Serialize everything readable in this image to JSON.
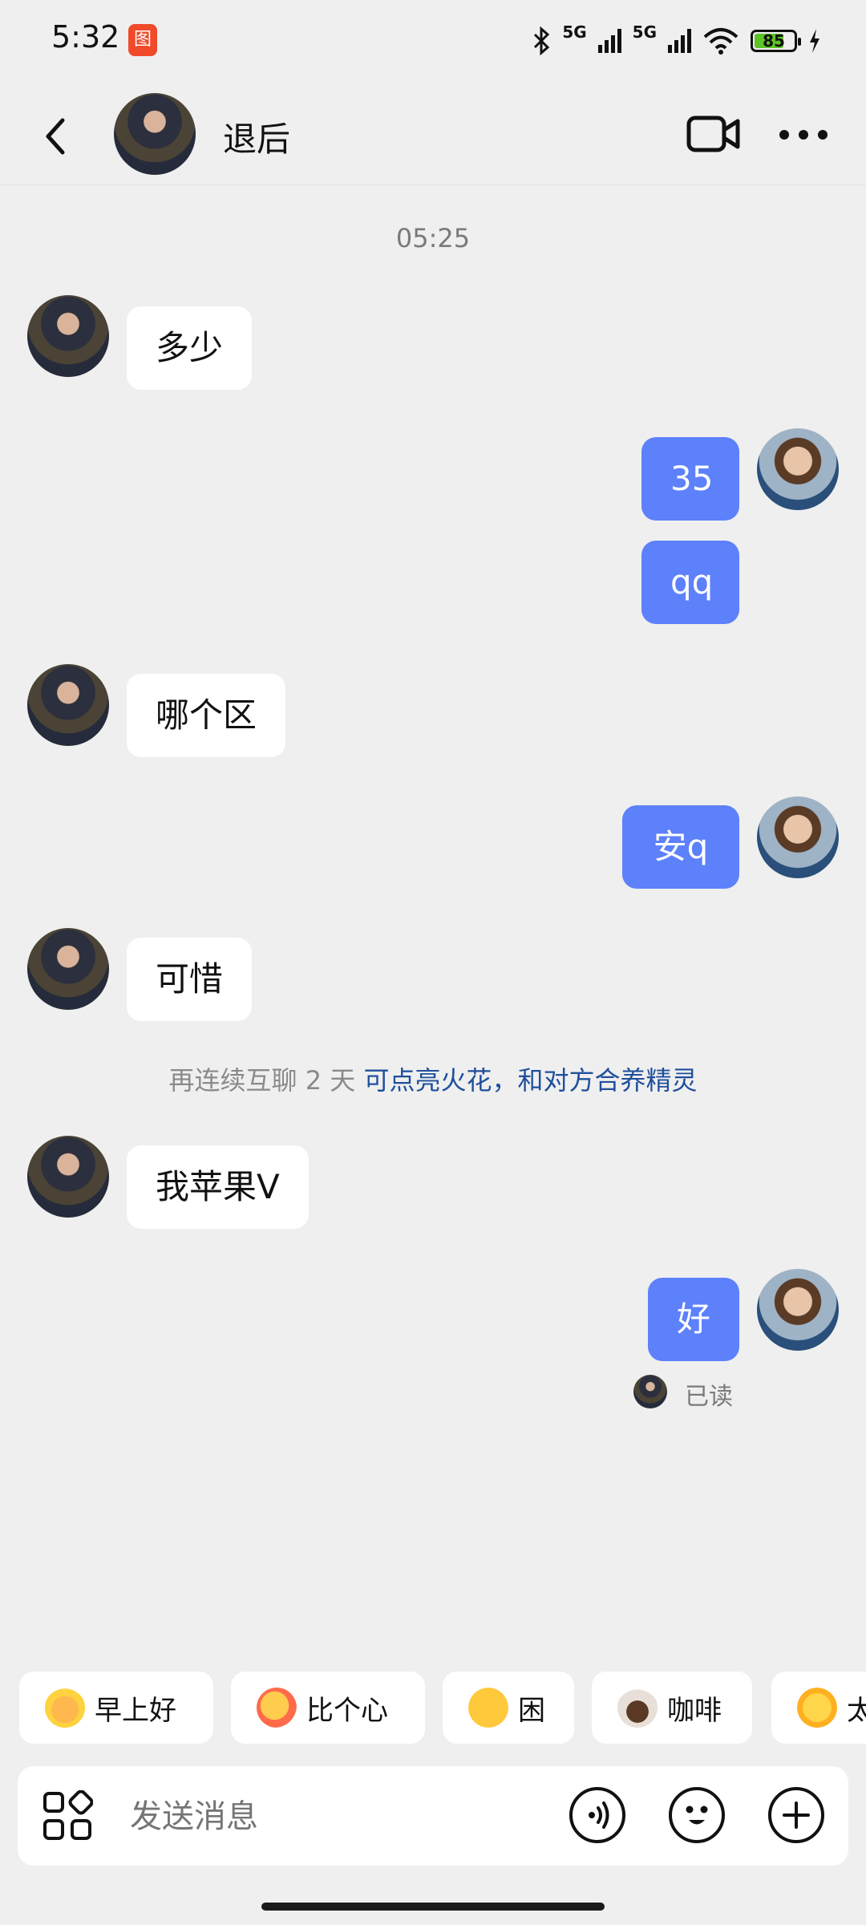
{
  "status_bar": {
    "time": "5:32",
    "app_badge": "图",
    "net1": "5G",
    "net2": "5G",
    "battery": "85"
  },
  "header": {
    "contact_name": "退后",
    "icons": [
      "back-icon",
      "video-call-icon",
      "more-icon"
    ]
  },
  "chat": {
    "timestamp": "05:25",
    "messages": [
      {
        "from": "contact",
        "text": "多少"
      },
      {
        "from": "me",
        "text": "35"
      },
      {
        "from": "me",
        "text": "qq"
      },
      {
        "from": "contact",
        "text": "哪个区"
      },
      {
        "from": "me",
        "text": "安q"
      },
      {
        "from": "contact",
        "text": "可惜"
      },
      {
        "from": "contact",
        "text": "我苹果V"
      },
      {
        "from": "me",
        "text": "好"
      }
    ],
    "hint_prefix": "再连续互聊 2 天",
    "hint_link": "可点亮火花，和对方合养精灵",
    "read_status": "已读"
  },
  "quick_replies": [
    {
      "icon": "sun-sunglasses-emoji",
      "label": "早上好"
    },
    {
      "icon": "heart-hands-emoji",
      "label": "比个心"
    },
    {
      "icon": "sleepy-face-emoji",
      "label": "困"
    },
    {
      "icon": "coffee-emoji",
      "label": "咖啡"
    },
    {
      "icon": "sun-smile-emoji",
      "label": "太"
    }
  ],
  "input": {
    "placeholder": "发送消息"
  },
  "colors": {
    "background": "#efefef",
    "outgoing_bubble": "#5d80fb",
    "hint_link": "#1f4f9c"
  }
}
